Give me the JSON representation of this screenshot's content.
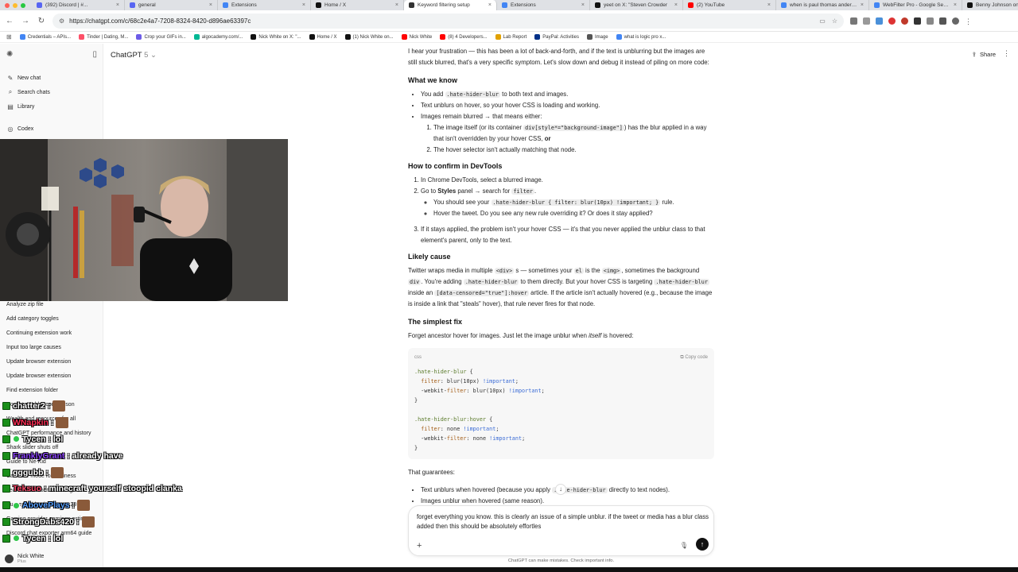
{
  "browser": {
    "tabs": [
      {
        "label": "(392) Discord | #...",
        "color": "#5865f2"
      },
      {
        "label": "general",
        "color": "#5865f2"
      },
      {
        "label": "Extensions",
        "color": "#4285f4"
      },
      {
        "label": "Home / X",
        "color": "#111111"
      },
      {
        "label": "Keyword filtering setup",
        "color": "#333333",
        "active": true
      },
      {
        "label": "Extensions",
        "color": "#4285f4"
      },
      {
        "label": "yeet on X: \"Steven Crowder",
        "color": "#111111"
      },
      {
        "label": "(2) YouTube",
        "color": "#ff0000"
      },
      {
        "label": "when is paul thomas anders...",
        "color": "#4285f4"
      },
      {
        "label": "WebFilter Pro - Google Search",
        "color": "#4285f4"
      },
      {
        "label": "Benny Johnson on X: \"No one",
        "color": "#111111"
      }
    ],
    "url": "https://chatgpt.com/c/68c2e4a7-7208-8324-8420-d896ae63397c",
    "bookmarks": [
      {
        "label": "Credentials – APIs...",
        "color": "#4285f4"
      },
      {
        "label": "Tinder | Dating, M...",
        "color": "#fd5068"
      },
      {
        "label": "Crop your GIFs in...",
        "color": "#6c5ce7"
      },
      {
        "label": "algocademy.com/...",
        "color": "#00b894"
      },
      {
        "label": "Nick White on X: \"...",
        "color": "#111111"
      },
      {
        "label": "Home / X",
        "color": "#111111"
      },
      {
        "label": "(1) Nick White on...",
        "color": "#111111"
      },
      {
        "label": "Nick White",
        "color": "#ff0000"
      },
      {
        "label": "(8) 4 Developers...",
        "color": "#ff0000"
      },
      {
        "label": "Lab Report",
        "color": "#e1a100"
      },
      {
        "label": "PayPal: Activities",
        "color": "#003087"
      },
      {
        "label": "Image",
        "color": "#555555"
      },
      {
        "label": "what is logic pro x...",
        "color": "#4285f4"
      }
    ]
  },
  "sidebar": {
    "nav": [
      {
        "label": "New chat",
        "icon": "✎"
      },
      {
        "label": "Search chats",
        "icon": "⌕"
      },
      {
        "label": "Library",
        "icon": "▤"
      },
      {
        "label": "Codex",
        "icon": "◎"
      }
    ],
    "chats": [
      "Analyze zip file",
      "Add category toggles",
      "Continuing extension work",
      "Input too large causes",
      "Update browser extension",
      "Update browser extension",
      "Find extension folder",
      "Rocket rumbler comparison",
      "Wealth and resources for all",
      "ChatGPT performance and history",
      "Shark slider shuts off",
      "Guide to Ne-Kid",
      "Calendar mode for business",
      "Leaf counter for tab settings",
      "Successful businesses at 28+",
      "Gaming provider earnings estimate",
      "Discord chat exporter arm64 guide"
    ],
    "user": {
      "name": "Nick White",
      "plan": "Plus"
    }
  },
  "stream_chat": [
    {
      "user": "chatter2",
      "color": "#ffffff",
      "msg": ":",
      "emote": true
    },
    {
      "user": "WNapkin",
      "color": "#ff2d55",
      "msg": ":",
      "emote": true
    },
    {
      "user": "Tycen",
      "color": "#ffffff",
      "msg": ": lol",
      "emote": false
    },
    {
      "user": "FranklyGrant",
      "color": "#8e44ff",
      "msg": ": already have",
      "emote": false
    },
    {
      "user": "gggubb",
      "color": "#ffffff",
      "msg": ":",
      "emote": true
    },
    {
      "user": "Teksuo",
      "color": "#ff4d6d",
      "msg": ": minecraft yourself stoopid clanka",
      "emote": false
    },
    {
      "user": "AbovePlays",
      "color": "#57a0ff",
      "msg": ":",
      "emote": true
    },
    {
      "user": "StrongDabs420",
      "color": "#ffffff",
      "msg": ":",
      "emote": true
    },
    {
      "user": "Tycen",
      "color": "#ffffff",
      "msg": ": lol",
      "emote": false
    }
  ],
  "header": {
    "model": "ChatGPT",
    "version": "5",
    "share": "Share"
  },
  "message": {
    "intro": "I hear your frustration — this has been a lot of back-and-forth, and if the text is unblurring but the images are still stuck blurred, that's a very specific symptom. Let's slow down and debug it instead of piling on more code:",
    "h_know": "What we know",
    "know_1a": "You add ",
    "know_1code": ".hate-hider-blur",
    "know_1b": " to both text and images.",
    "know_2": "Text unblurs on hover, so your hover CSS is loading and working.",
    "know_3": "Images remain blurred → that means either:",
    "know_3_1a": "The image itself (or its container ",
    "know_3_1code": "div[style*=\"background-image\"]",
    "know_3_1b": ") has the blur applied in a way that isn't overridden by your hover CSS, ",
    "know_3_1or": "or",
    "know_3_2": "The hover selector isn't actually matching that node.",
    "h_confirm": "How to confirm in DevTools",
    "conf_1": "In Chrome DevTools, select a blurred image.",
    "conf_2a": "Go to ",
    "conf_2b": "Styles",
    "conf_2c": " panel → search for ",
    "conf_2code": "filter",
    "conf_2d": ".",
    "conf_2_1a": "You should see your ",
    "conf_2_1code": ".hate-hider-blur { filter: blur(10px) !important; }",
    "conf_2_1b": " rule.",
    "conf_2_2": "Hover the tweet. Do you see any new rule overriding it? Or does it stay applied?",
    "conf_3": "If it stays applied, the problem isn't your hover CSS — it's that you never applied the unblur class to that element's parent, only to the text.",
    "h_cause": "Likely cause",
    "cause_a": "Twitter wraps media in multiple ",
    "cause_code1": "<div>",
    "cause_b": " s — sometimes your ",
    "cause_code2": "el",
    "cause_c": " is the ",
    "cause_code3": "<img>",
    "cause_d": ", sometimes the background ",
    "cause_code4": "div",
    "cause_e": ". You're adding ",
    "cause_code5": ".hate-hider-blur",
    "cause_f": " to them directly. But your hover CSS is targeting ",
    "cause_code6": ".hate-hider-blur",
    "cause_g": " inside an ",
    "cause_code7": "[data-censored=\"true\"]:hover",
    "cause_h": " article. If the article isn't actually hovered (e.g., because the image is inside a link that \"steals\" hover), that rule never fires for that node.",
    "h_fix": "The simplest fix",
    "fix_a": "Forget ancestor hover for images. Just let the image unblur when ",
    "fix_em": "itself",
    "fix_b": " is hovered:",
    "code_lang": "css",
    "copy_label": "Copy code",
    "guar": "That guarantees:",
    "guar_1a": "Text unblurs when hovered (because you apply ",
    "guar_1code": ".hate-hider-blur",
    "guar_1b": " directly to text nodes).",
    "guar_2": "Images unblur when hovered (same reason)."
  },
  "composer": {
    "text": "forget everything you know. this is clearly an issue of a simple unblur. if the tweet or media has a blur class added then this should be absolutely effortles"
  },
  "disclaimer": "ChatGPT can make mistakes. Check important info."
}
